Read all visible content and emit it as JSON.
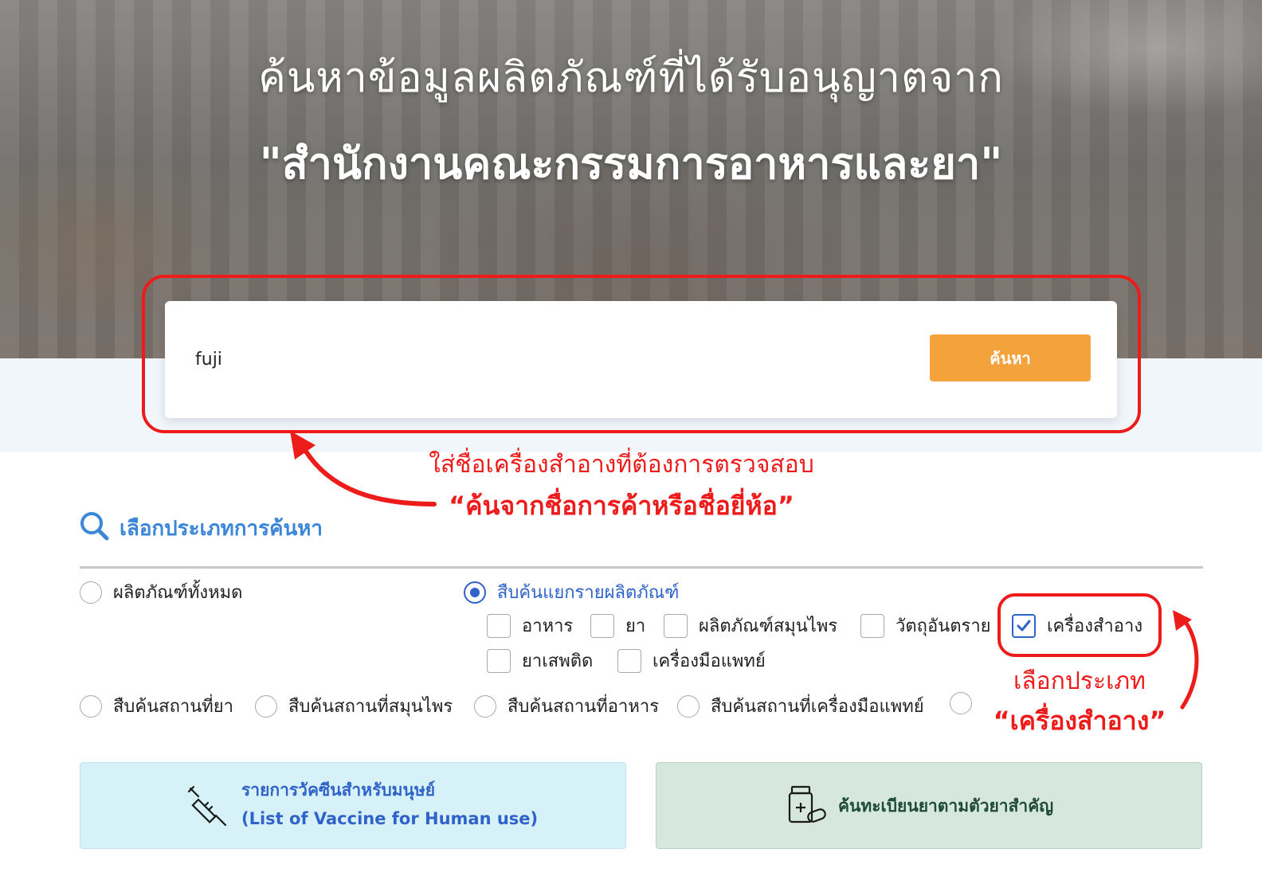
{
  "hero": {
    "title_line1": "ค้นหาข้อมูลผลิตภัณฑ์ที่ได้รับอนุญาตจาก",
    "title_line2": "\"สำนักงานคณะกรรมการอาหารและยา\""
  },
  "search": {
    "value": "fuji",
    "button_label": "ค้นหา"
  },
  "annotations": {
    "search_hint_line1": "ใส่ชื่อเครื่องสำอางที่ต้องการตรวจสอบ",
    "search_hint_line2": "“ค้นจากชื่อการค้าหรือชื่อยี่ห้อ”",
    "category_hint_line1": "เลือกประเภท",
    "category_hint_line2": "“เครื่องสำอาง”",
    "color": "#ee1b1b"
  },
  "search_type": {
    "title": "เลือกประเภทการค้นหา",
    "all_products": "ผลิตภัณฑ์ทั้งหมด",
    "by_product": "สืบค้นแยกรายผลิตภัณฑ์",
    "categories": [
      {
        "label": "อาหาร",
        "checked": false
      },
      {
        "label": "ยา",
        "checked": false
      },
      {
        "label": "ผลิตภัณฑ์สมุนไพร",
        "checked": false
      },
      {
        "label": "วัตถุอันตราย",
        "checked": false
      },
      {
        "label": "เครื่องสำอาง",
        "checked": true
      },
      {
        "label": "ยาเสพติด",
        "checked": false
      },
      {
        "label": "เครื่องมือแพทย์",
        "checked": false
      }
    ],
    "places": [
      "สืบค้นสถานที่ยา",
      "สืบค้นสถานที่สมุนไพร",
      "สืบค้นสถานที่อาหาร",
      "สืบค้นสถานที่เครื่องมือแพทย์"
    ]
  },
  "cards": {
    "vaccine_line1": "รายการวัคซีนสำหรับมนุษย์",
    "vaccine_line2": "(List of Vaccine for Human use)",
    "drug_search": "ค้นทะเบียนยาตามตัวยาสำคัญ"
  },
  "colors": {
    "accent_blue": "#2f63c9",
    "search_button": "#f3a23c",
    "vaccine_card": "#d6f1f7",
    "drug_card": "#d6e7dd"
  }
}
